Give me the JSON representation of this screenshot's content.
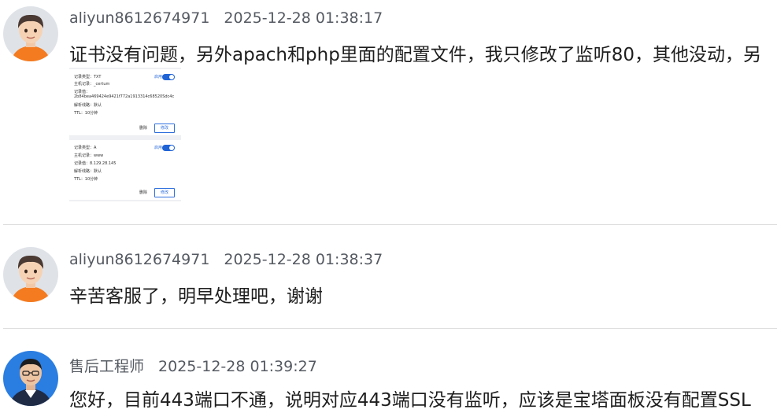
{
  "messages": [
    {
      "user": "aliyun8612674971",
      "time": "2025-12-28 01:38:17",
      "text": "证书没有问题，另外apach和php里面的配置文件，我只修改了监听80，其他没动，另",
      "attachment": {
        "records": [
          {
            "lines": [
              "记录类型：TXT",
              "主机记录：_certum",
              "记录值：",
              "2b84bea469424e9421f772a1913314c68520Sdc4c",
              "解析线路：默认",
              "TTL：10分钟"
            ],
            "status": "启用",
            "delete_label": "删除",
            "edit_label": "修改"
          },
          {
            "lines": [
              "记录类型：A",
              "主机记录：www",
              "记录值：8.129.28.145",
              "解析线路：默认",
              "TTL：10分钟"
            ],
            "status": "启用",
            "delete_label": "删除",
            "edit_label": "修改"
          }
        ]
      }
    },
    {
      "user": "aliyun8612674971",
      "time": "2025-12-28 01:38:37",
      "text": "辛苦客服了，明早处理吧，谢谢"
    },
    {
      "user": "售后工程师",
      "time": "2025-12-28 01:39:27",
      "text": "您好，目前443端口不通，说明对应443端口没有监听，应该是宝塔面板没有配置SSL"
    }
  ],
  "colors": {
    "user_avatar_shirt": "#f47b20",
    "engineer_avatar_bg": "#2a7de1"
  }
}
